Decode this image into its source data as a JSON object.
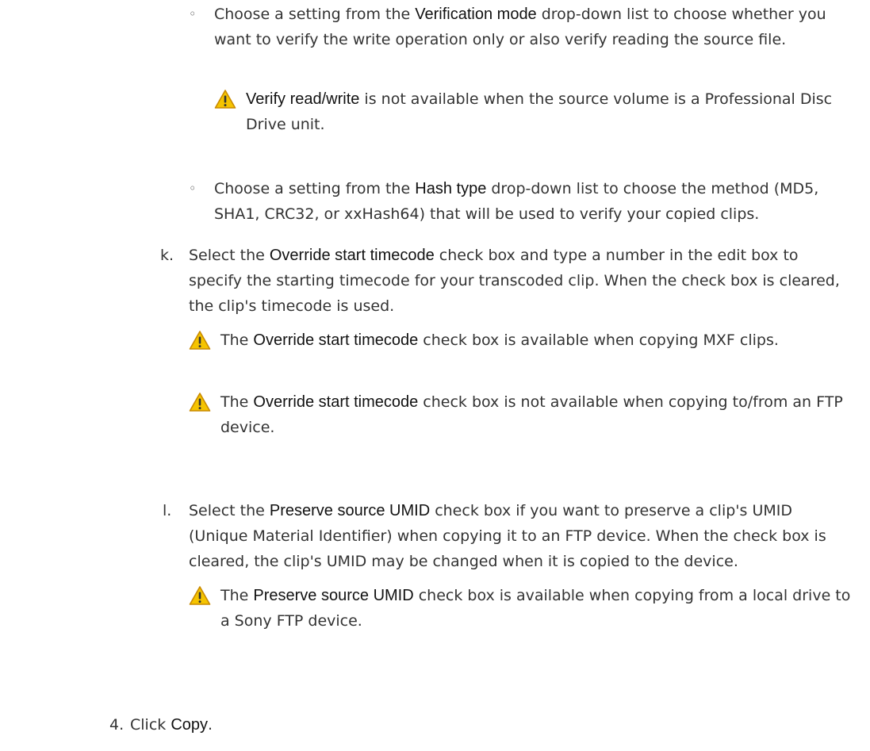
{
  "items": {
    "verification": {
      "marker": "◦",
      "pre": "Choose a setting from the ",
      "bold": "Verification mode",
      "post": " drop-down list to choose whether you want to verify the write operation only or also verify reading the source file.",
      "note": {
        "bold": "Verify read/write",
        "post": " is not available when the source volume is a Professional Disc Drive unit."
      }
    },
    "hash": {
      "marker": "◦",
      "pre": "Choose a setting from the ",
      "bold": "Hash type",
      "post": " drop-down list to choose the method (MD5, SHA1, CRC32, or xxHash64) that will be used to verify your copied clips."
    },
    "k": {
      "marker": "k.",
      "pre": "Select the ",
      "bold": "Override start timecode",
      "post": " check box and type a number in the edit box to specify the starting timecode for your transcoded clip. When the check box is cleared, the clip's timecode is used.",
      "note1": {
        "pre": "The ",
        "bold": "Override start timecode",
        "post": " check box is available when copying MXF clips."
      },
      "note2": {
        "pre": "The ",
        "bold": "Override start timecode",
        "post": " check box is not available when copying to/from an FTP device."
      }
    },
    "l": {
      "marker": "l.",
      "pre": "Select the ",
      "bold": "Preserve source UMID",
      "post": " check box if you want to preserve a clip's UMID (Unique Material Identifier) when copying it to an FTP device. When the check box is cleared, the clip's UMID may be changed when it is copied to the device.",
      "note": {
        "pre": "The ",
        "bold": "Preserve source UMID",
        "post": " check box is available when copying from a local drive to a Sony FTP device."
      }
    },
    "step4": {
      "marker": "4.",
      "pre": "Click ",
      "bold": "Copy",
      "post": "."
    }
  },
  "colors": {
    "warning_fill": "#f5c400",
    "warning_stroke": "#c98a00",
    "text": "#333333"
  },
  "icons": {
    "warning": "warning-triangle-icon"
  }
}
